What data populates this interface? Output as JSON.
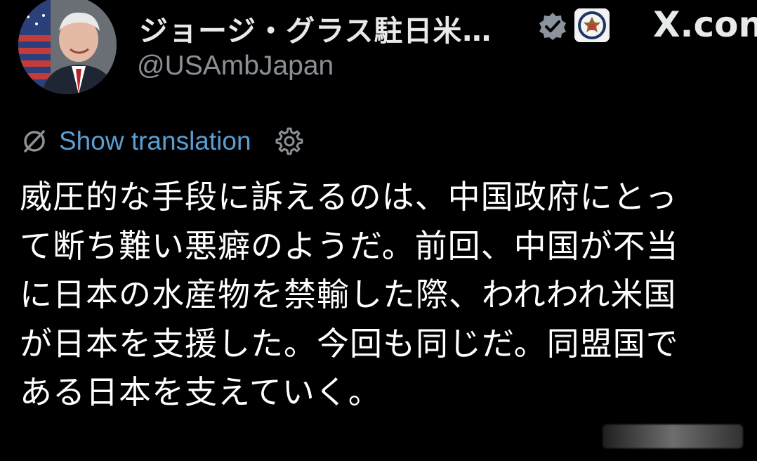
{
  "profile": {
    "display_name": "ジョージ・グラス駐日米…",
    "handle": "@USAmbJapan",
    "verified_icon": "verified-badge-icon",
    "affiliation_icon": "us-state-department-seal-icon"
  },
  "brand": {
    "label": "X.con"
  },
  "translation": {
    "label": "Show translation",
    "icon": "no-translate-icon",
    "settings_icon": "gear-icon"
  },
  "tweet": {
    "lines": [
      "威圧的な手段に訴えるのは、中国政府にとっ",
      "て断ち難い悪癖のようだ。前回、中国が不当",
      "に日本の水産物を禁輸した際、われわれ米国",
      "が日本を支援した。今回も同じだ。同盟国で",
      "ある日本を支えていく。"
    ]
  },
  "colors": {
    "background": "#000000",
    "text": "#ffffff",
    "handle": "#8b9096",
    "link": "#5a9fd4"
  }
}
